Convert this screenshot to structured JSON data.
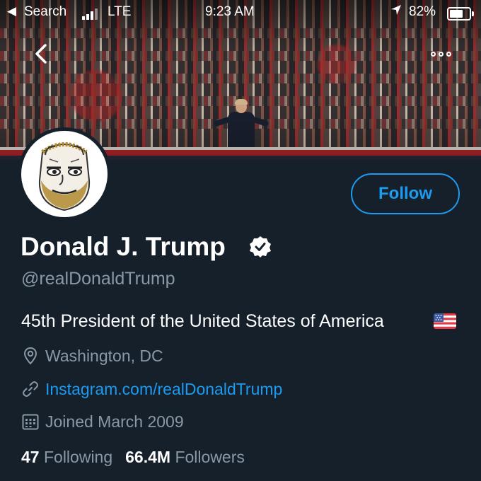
{
  "status_bar": {
    "back_glyph": "◀",
    "carrier": "Search",
    "network": "LTE",
    "time": "9:23 AM",
    "battery_pct": "82%",
    "battery_level": 0.82
  },
  "nav": {
    "back_icon": "chevron-left-icon",
    "more_icon": "more-horizontal-icon"
  },
  "profile": {
    "name": "Donald J. Trump",
    "verified": true,
    "handle": "@realDonaldTrump",
    "bio": "45th President of the United States of America",
    "location": "Washington, DC",
    "website": "Instagram.com/realDonaldTrump",
    "joined": "Joined March 2009",
    "following_count": "47",
    "following_label": "Following",
    "followers_count": "66.4M",
    "followers_label": "Followers"
  },
  "actions": {
    "follow_label": "Follow"
  },
  "colors": {
    "background": "#15202b",
    "accent": "#1d9bf0",
    "secondary_text": "#8b98a5",
    "primary_text": "#ffffff"
  }
}
